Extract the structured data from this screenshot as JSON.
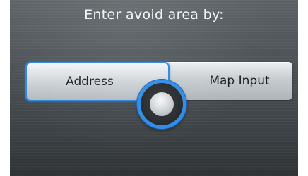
{
  "screen": {
    "title": "Enter avoid area by:"
  },
  "options": [
    {
      "label": "Address",
      "selected": true
    },
    {
      "label": "Map Input",
      "selected": false
    }
  ],
  "colors": {
    "selection_accent": "#2e86e0",
    "background": "#4d5357"
  },
  "controls": {
    "joystick_icon": "interface-dial-icon"
  }
}
